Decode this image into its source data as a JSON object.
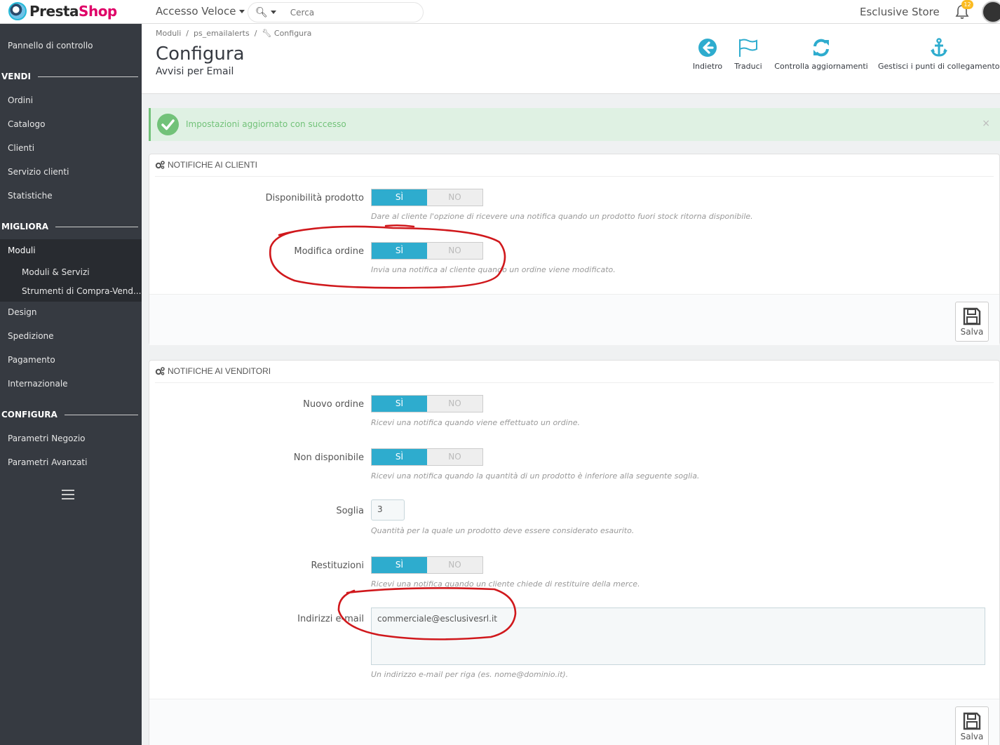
{
  "header": {
    "logo_part1": "Presta",
    "logo_part2": "Shop",
    "quick_access": "Accesso Veloce",
    "search_placeholder": "Cerca",
    "store_name": "Esclusive Store",
    "notifications_count": "12"
  },
  "sidebar": {
    "dashboard": "Pannello di controllo",
    "section_sell": "VENDI",
    "orders": "Ordini",
    "catalog": "Catalogo",
    "customers": "Clienti",
    "customer_service": "Servizio clienti",
    "stats": "Statistiche",
    "section_improve": "MIGLIORA",
    "modules": "Moduli",
    "modules_services": "Moduli & Servizi",
    "marketplace_tools": "Strumenti di Compra-Vend...",
    "design": "Design",
    "shipping": "Spedizione",
    "payment": "Pagamento",
    "international": "Internazionale",
    "section_configure": "CONFIGURA",
    "shop_params": "Parametri Negozio",
    "advanced_params": "Parametri Avanzati"
  },
  "page": {
    "breadcrumb": [
      "Moduli",
      "ps_emailalerts",
      "Configura"
    ],
    "title": "Configura",
    "subtitle": "Avvisi per Email",
    "toolbar": {
      "back": "Indietro",
      "translate": "Traduci",
      "check_updates": "Controlla aggiornamenti",
      "hooks": "Gestisci i punti di collegamento"
    }
  },
  "alert": {
    "message": "Impostazioni aggiornato con successo",
    "close": "×"
  },
  "panel_customers": {
    "title": "NOTIFICHE AI CLIENTI",
    "fields": [
      {
        "label": "Disponibilità prodotto",
        "yes": "SÌ",
        "no": "NO",
        "value": "SÌ",
        "help": "Dare al cliente l'opzione di ricevere una notifica quando un prodotto fuori stock ritorna disponibile."
      },
      {
        "label": "Modifica ordine",
        "yes": "SÌ",
        "no": "NO",
        "value": "SÌ",
        "help": "Invia una notifica al cliente quando un ordine viene modificato."
      }
    ],
    "save": "Salva"
  },
  "panel_merchants": {
    "title": "NOTIFICHE AI VENDITORI",
    "fields": [
      {
        "label": "Nuovo ordine",
        "yes": "SÌ",
        "no": "NO",
        "value": "SÌ",
        "help": "Ricevi una notifica quando viene effettuato un ordine."
      },
      {
        "label": "Non disponibile",
        "yes": "SÌ",
        "no": "NO",
        "value": "SÌ",
        "help": "Ricevi una notifica quando la quantità di un prodotto è inferiore alla seguente soglia."
      },
      {
        "label": "Soglia",
        "value": "3",
        "help": "Quantità per la quale un prodotto deve essere considerato esaurito."
      },
      {
        "label": "Restituzioni",
        "yes": "SÌ",
        "no": "NO",
        "value": "SÌ",
        "help": "Ricevi una notifica quando un cliente chiede di restituire della merce."
      },
      {
        "label": "Indirizzi e-mail",
        "value": "commerciale@esclusivesrl.it",
        "help": "Un indirizzo e-mail per riga (es. nome@dominio.it)."
      }
    ],
    "save": "Salva"
  },
  "colors": {
    "accent": "#2eacce",
    "sidebar_bg": "#363a41",
    "success": "#72c279",
    "annotation": "#d0181c"
  }
}
